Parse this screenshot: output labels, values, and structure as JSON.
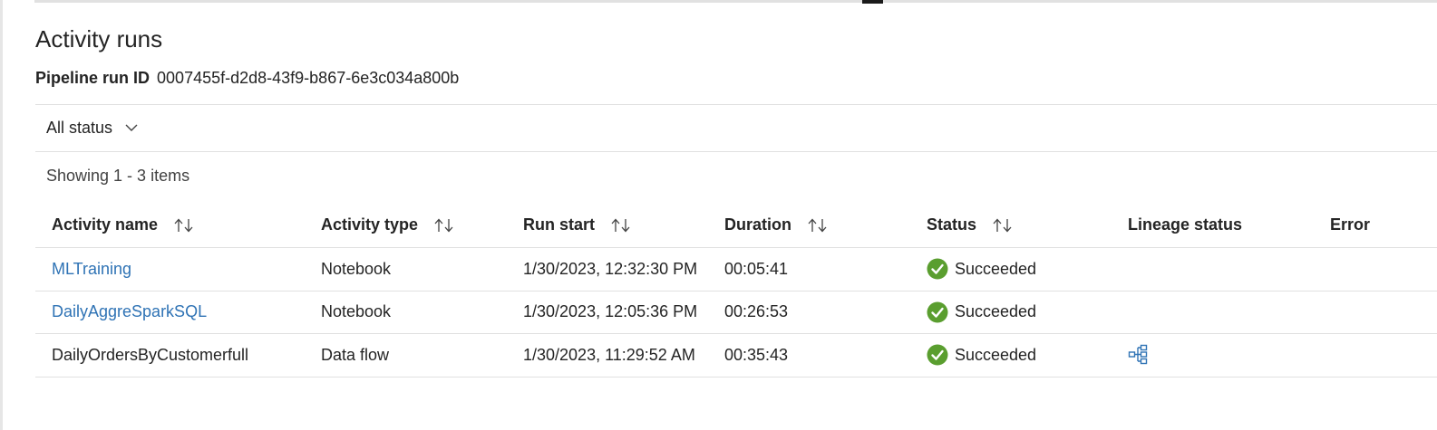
{
  "page": {
    "title": "Activity runs",
    "pipeline_run_id_label": "Pipeline run ID",
    "pipeline_run_id": "0007455f-d2d8-43f9-b867-6e3c034a800b"
  },
  "filter": {
    "status_label": "All status",
    "icon": "chevron-down-icon"
  },
  "summary": {
    "showing_text": "Showing 1 - 3 items"
  },
  "table": {
    "columns": [
      {
        "label": "Activity name",
        "sortable": true
      },
      {
        "label": "Activity type",
        "sortable": true
      },
      {
        "label": "Run start",
        "sortable": true
      },
      {
        "label": "Duration",
        "sortable": true
      },
      {
        "label": "Status",
        "sortable": true
      },
      {
        "label": "Lineage status",
        "sortable": false
      },
      {
        "label": "Error",
        "sortable": false
      }
    ],
    "rows": [
      {
        "activity_name": "MLTraining",
        "is_link": true,
        "activity_type": "Notebook",
        "run_start": "1/30/2023, 12:32:30 PM",
        "duration": "00:05:41",
        "status": "Succeeded",
        "lineage_icon": null,
        "error": ""
      },
      {
        "activity_name": "DailyAggreSparkSQL",
        "is_link": true,
        "activity_type": "Notebook",
        "run_start": "1/30/2023, 12:05:36 PM",
        "duration": "00:26:53",
        "status": "Succeeded",
        "lineage_icon": null,
        "error": ""
      },
      {
        "activity_name": "DailyOrdersByCustomerfull",
        "is_link": false,
        "activity_type": "Data flow",
        "run_start": "1/30/2023, 11:29:52 AM",
        "duration": "00:35:43",
        "status": "Succeeded",
        "lineage_icon": "lineage-diagram-icon",
        "error": ""
      }
    ]
  },
  "colors": {
    "link": "#2f73b5",
    "success": "#5a9e2f",
    "lineage_icon": "#2f73b5",
    "divider": "#e0e0e0"
  }
}
